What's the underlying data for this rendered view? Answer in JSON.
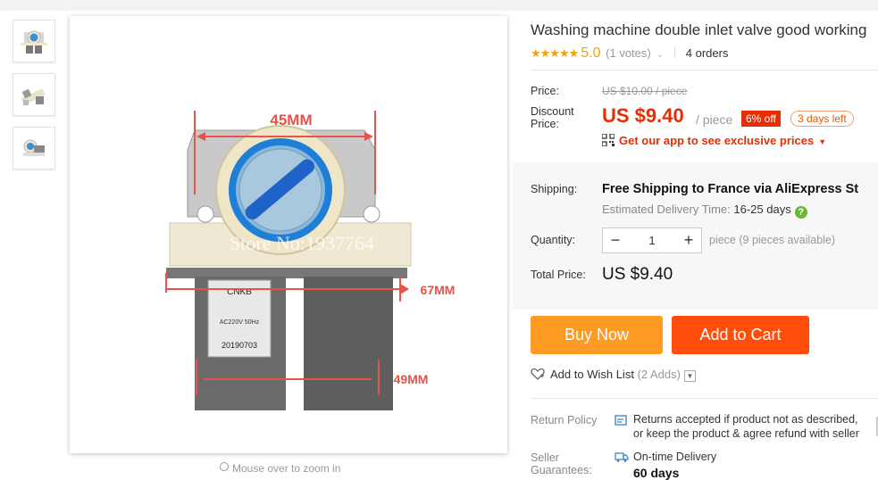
{
  "product": {
    "title": "Washing machine double inlet valve good working",
    "rating_stars": "★★★★★",
    "rating_score": "5.0",
    "votes": "(1 votes)",
    "orders": "4 orders"
  },
  "image": {
    "dimension_width": "45MM",
    "dimension_height": "67MM",
    "dimension_depth": "49MM",
    "watermark": "Store No:1937764",
    "label_brand": "CNKB",
    "label_rating": "AC220V 50Hz",
    "label_code": "20190703",
    "zoom_hint": "Mouse over to zoom in"
  },
  "price": {
    "label": "Price:",
    "original": "US $10.00 / piece",
    "discount_label_1": "Discount",
    "discount_label_2": "Price:",
    "current": "US $9.40",
    "per": "/ piece",
    "off_badge": "6% off",
    "days_left": "3 days left",
    "app_promo": "Get our app to see exclusive prices"
  },
  "shipping": {
    "label": "Shipping:",
    "main": "Free Shipping to France via AliExpress St",
    "estimated_label": "Estimated Delivery Time:",
    "estimated_value": "16-25 days"
  },
  "quantity": {
    "label": "Quantity:",
    "minus": "−",
    "value": "1",
    "plus": "+",
    "available": "piece (9 pieces available)"
  },
  "total": {
    "label": "Total Price:",
    "value": "US $9.40"
  },
  "actions": {
    "buy_now": "Buy Now",
    "add_to_cart": "Add to Cart",
    "wish_list": "Add to Wish List",
    "wish_adds": "(2 Adds)"
  },
  "policy": {
    "label": "Return Policy",
    "line1": "Returns accepted if product not as described,",
    "line2": "or keep the product & agree refund with seller"
  },
  "seller": {
    "label_1": "Seller",
    "label_2": "Guarantees:",
    "on_time": "On-time Delivery",
    "days": "60 days"
  },
  "colors": {
    "accent_red": "#e62e04",
    "star_orange": "#f2a20c",
    "buy_orange": "#ff9b24",
    "cart_orange": "#ff4e0c"
  }
}
